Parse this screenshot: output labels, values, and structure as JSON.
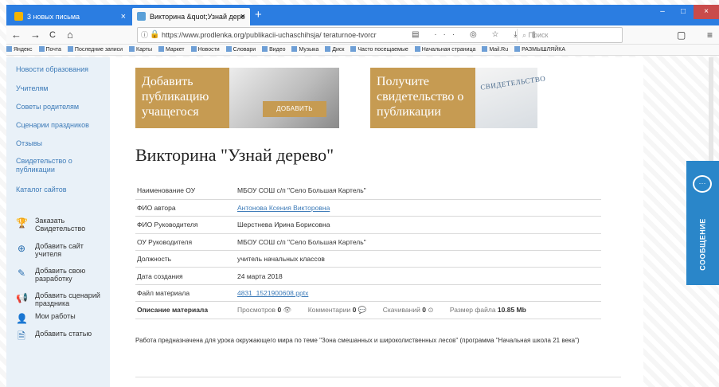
{
  "browser": {
    "tabs": [
      {
        "label": "3 новых письма",
        "close": "×"
      },
      {
        "label": "Викторина &quot;Узнай дере",
        "close": "×"
      }
    ],
    "new_tab": "+",
    "window_controls": [
      "–",
      "□",
      "×"
    ],
    "nav": {
      "back": "←",
      "forward": "→",
      "reload": "C",
      "home": "⌂"
    },
    "url": "https://www.prodlenka.org/publikacii-uchaschihsja/ teraturnoe-tvorcr",
    "url_icons": "▤ ··· ◎ ☆ ⤓ ⫴",
    "search_placeholder": "Поиск",
    "right_icons": [
      "▢",
      "≡",
      "»"
    ],
    "bookmarks": [
      "Яндекс",
      "Почта",
      "Последние записи",
      "Карты",
      "Маркет",
      "Новости",
      "Словари",
      "Видео",
      "Музыка",
      "Диск",
      "Часто посещаемые",
      "Начальная страница",
      "Mail.Ru",
      "РАЗМЫШЛЯЙКА"
    ]
  },
  "sidebar": {
    "links": [
      "Новости образования",
      "Учителям",
      "Советы родителям",
      "Сценарии праздников",
      "Отзывы",
      "Свидетельство о публикации",
      "Каталог сайтов"
    ],
    "actions": [
      {
        "icon": "trophy-icon",
        "label": "Заказать Свидетельство"
      },
      {
        "icon": "plus-circle-icon",
        "label": "Добавить сайт учителя"
      },
      {
        "icon": "edit-icon",
        "label": "Добавить свою разработку"
      },
      {
        "icon": "megaphone-icon",
        "label": "Добавить сценарий праздника"
      },
      {
        "icon": "user-icon",
        "label": "Мои работы"
      },
      {
        "icon": "document-icon",
        "label": "Добавить статью"
      }
    ]
  },
  "banners": {
    "left_text": "Добавить публикацию учащегося",
    "left_button": "ДОБАВИТЬ",
    "right_text": "Получите свидетельство о публикации",
    "cert_text": "СВИДЕТЕЛЬСТВО"
  },
  "page": {
    "title": "Викторина \"Узнай дерево\"",
    "rows": [
      {
        "key": "Наименование ОУ",
        "value": "МБОУ СОШ с/п \"Село Большая Картель\""
      },
      {
        "key": "ФИО автора",
        "value": "Антонова Ксения Викторовна",
        "link": true
      },
      {
        "key": "ФИО Руководителя",
        "value": "Шерстнева Ирина Борисовна"
      },
      {
        "key": "ОУ Руководителя",
        "value": "МБОУ СОШ с/п \"Село Большая Картель\""
      },
      {
        "key": "Должность",
        "value": "учитель начальных классов"
      },
      {
        "key": "Дата создания",
        "value": "24 марта 2018"
      },
      {
        "key": "Файл материала",
        "value": "4831_1521900608.pptx",
        "link": true
      },
      {
        "key": "Описание материала",
        "value": ""
      }
    ],
    "stats": {
      "views_label": "Просмотров",
      "views": "0",
      "comments_label": "Комментарии",
      "comments": "0",
      "downloads_label": "Скачиваний",
      "downloads": "0",
      "size_label": "Размер файла",
      "size": "10.85 Mb"
    },
    "description": "Работа предназначена для урока окружающего мира по теме \"Зона смешанных и широколиственных лесов\" (программа \"Начальная школа 21 века\")"
  },
  "widget": {
    "label": "СООБЩЕНИЕ",
    "icon": "chat-bubble-icon"
  }
}
